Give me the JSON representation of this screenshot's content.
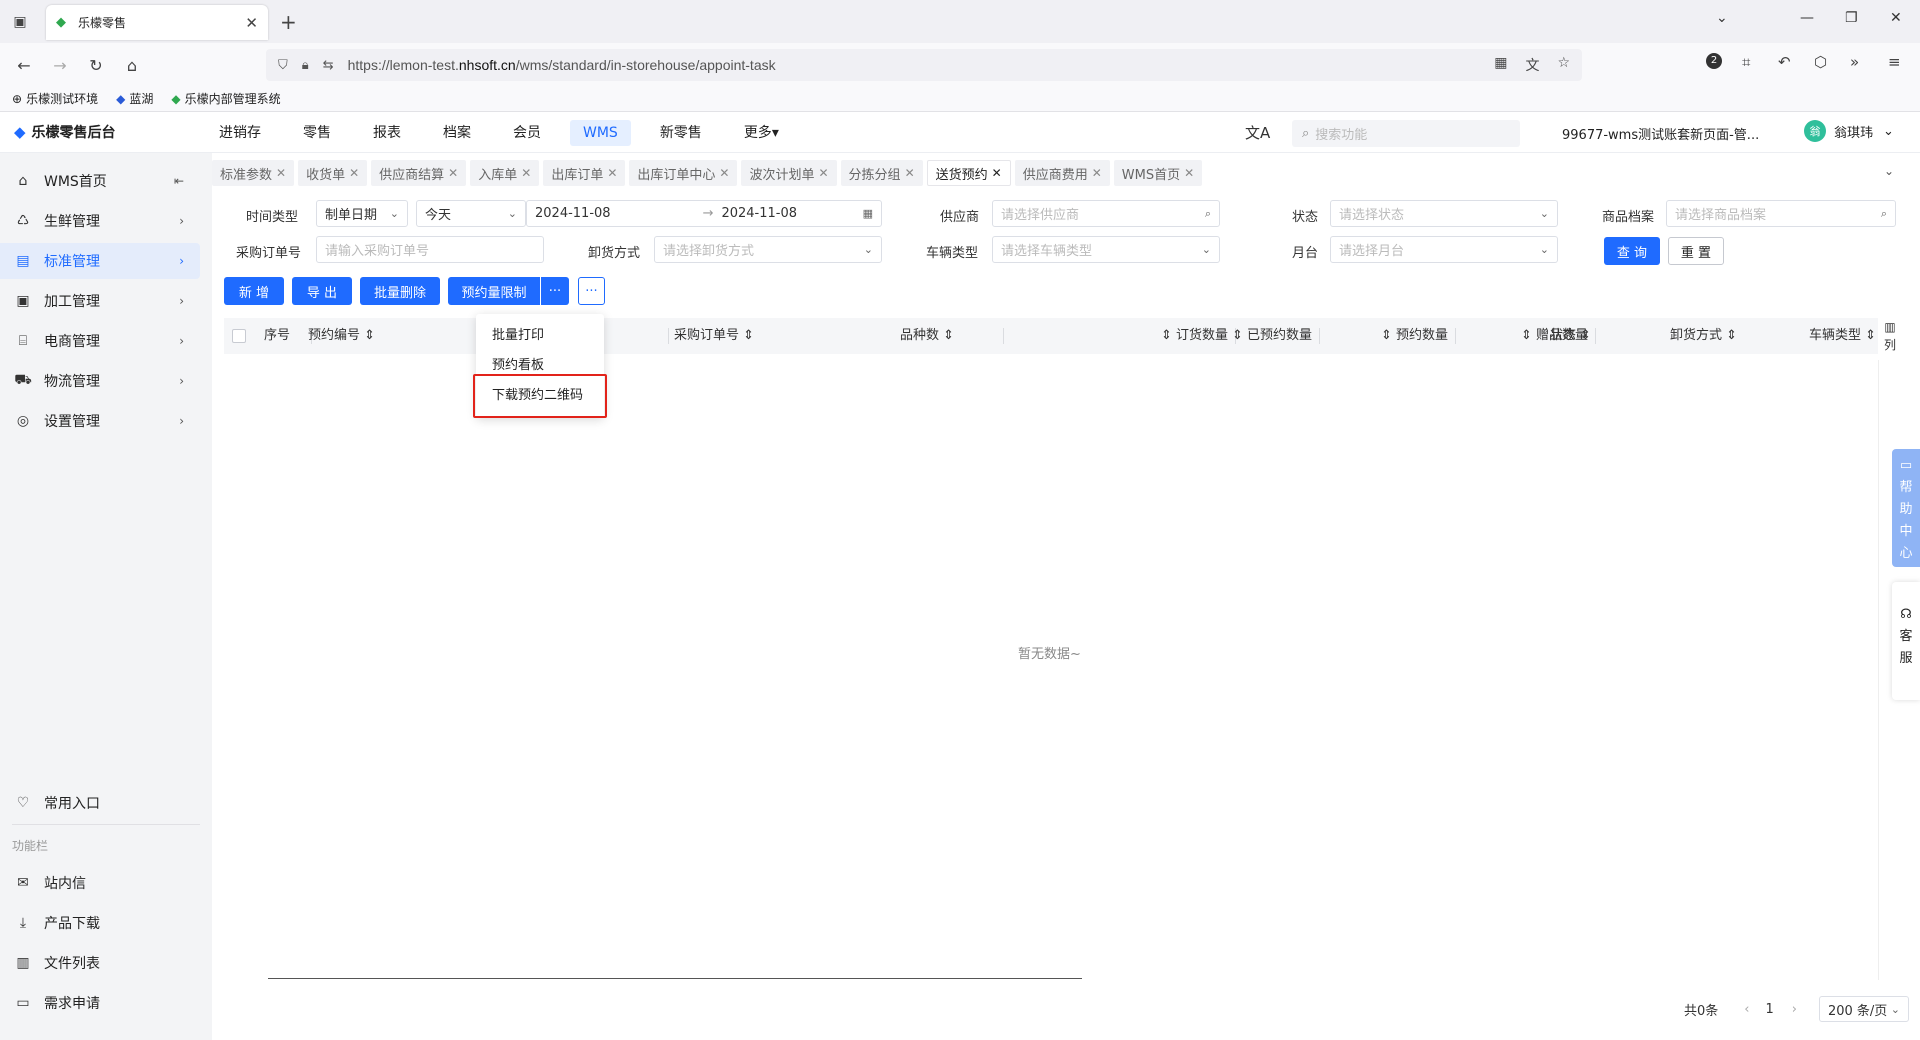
{
  "browser": {
    "tab_title": "乐檬零售",
    "url_prefix": "https://lemon-test.",
    "url_domain": "nhsoft.cn",
    "url_path": "/wms/standard/in-storehouse/appoint-task",
    "bookmarks": [
      "乐檬测试环境",
      "蓝湖",
      "乐檬内部管理系统"
    ],
    "ext_badge": "2"
  },
  "app": {
    "logo_text": "乐檬零售后台",
    "nav": [
      "进销存",
      "零售",
      "报表",
      "档案",
      "会员",
      "WMS",
      "新零售",
      "更多"
    ],
    "active_nav": "WMS",
    "search_placeholder": "搜索功能",
    "account": "99677-wms测试账套新页面-管...",
    "user_name": "翁琪玮",
    "avatar_text": "翁"
  },
  "sidebar": {
    "items": [
      {
        "label": "WMS首页",
        "icon": "home-icon"
      },
      {
        "label": "生鲜管理",
        "icon": "fresh-icon"
      },
      {
        "label": "标准管理",
        "icon": "standard-icon"
      },
      {
        "label": "加工管理",
        "icon": "process-icon"
      },
      {
        "label": "电商管理",
        "icon": "shop-icon"
      },
      {
        "label": "物流管理",
        "icon": "truck-icon"
      },
      {
        "label": "设置管理",
        "icon": "settings-icon"
      }
    ],
    "favorites": "常用入口",
    "group_title": "功能栏",
    "func_items": [
      "站内信",
      "产品下载",
      "文件列表",
      "需求申请"
    ]
  },
  "page_tabs": [
    "标准参数",
    "收货单",
    "供应商结算",
    "入库单",
    "出库订单",
    "出库订单中心",
    "波次计划单",
    "分拣分组",
    "送货预约",
    "供应商费用",
    "WMS首页"
  ],
  "active_tab": "送货预约",
  "filters": {
    "time_type_label": "时间类型",
    "time_type_value": "制单日期",
    "range_value": "今天",
    "date_start": "2024-11-08",
    "date_end": "2024-11-08",
    "supplier_label": "供应商",
    "supplier_placeholder": "请选择供应商",
    "status_label": "状态",
    "status_placeholder": "请选择状态",
    "goods_label": "商品档案",
    "goods_placeholder": "请选择商品档案",
    "po_label": "采购订单号",
    "po_placeholder": "请输入采购订单号",
    "unload_label": "卸货方式",
    "unload_placeholder": "请选择卸货方式",
    "vehicle_label": "车辆类型",
    "vehicle_placeholder": "请选择车辆类型",
    "dock_label": "月台",
    "dock_placeholder": "请选择月台",
    "query": "查 询",
    "reset": "重 置"
  },
  "toolbar": {
    "add": "新 增",
    "export": "导 出",
    "batch_delete": "批量删除",
    "limit": "预约量限制",
    "more": "···"
  },
  "dropdown": [
    "批量打印",
    "预约看板",
    "下载预约二维码"
  ],
  "table": {
    "columns": [
      "序号",
      "预约编号",
      "采购订单号",
      "品种数",
      "订货数量",
      "已预约数量",
      "预约数量",
      "赠品数量",
      "状态",
      "卸货方式",
      "车辆类型"
    ],
    "empty_text": "暂无数据~",
    "column_setting": "列"
  },
  "floaters": {
    "help_chars": [
      "帮",
      "助",
      "中",
      "心"
    ],
    "service_chars": [
      "客",
      "服"
    ]
  },
  "pager": {
    "total": "共0条",
    "page": "1",
    "size": "200 条/页"
  },
  "colors": {
    "primary": "#1f6bff",
    "highlight": "#e2231a"
  }
}
